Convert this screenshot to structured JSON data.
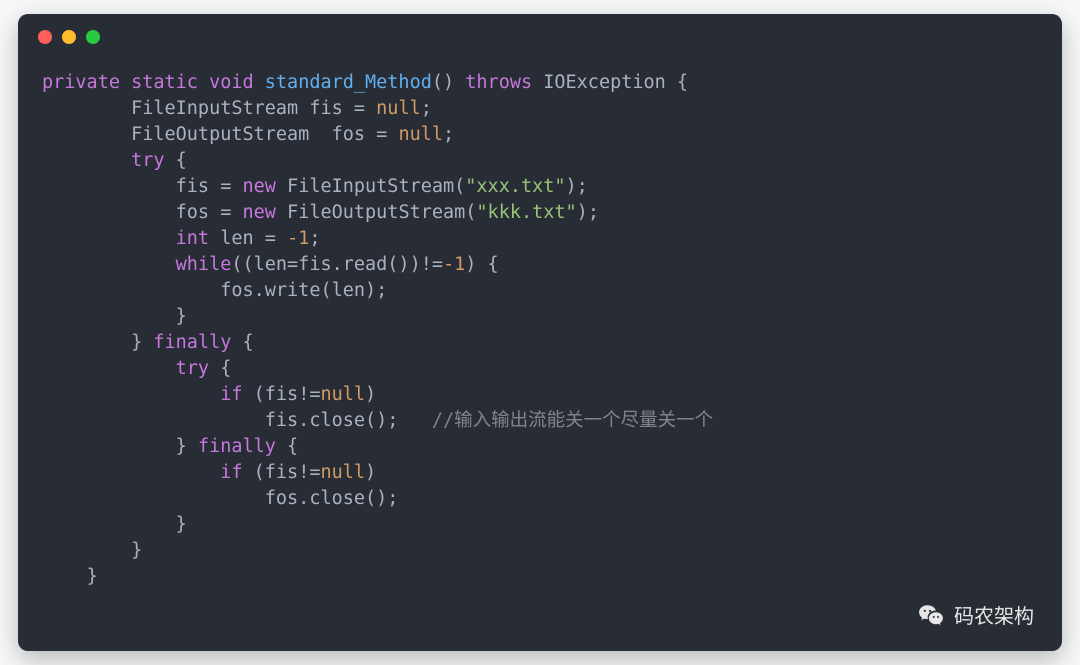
{
  "code": {
    "l1": {
      "kw1": "private",
      "kw2": "static",
      "kw3": "void",
      "fn": "standard_Method",
      "paren": "()",
      "kw4": "throws",
      "ex": "IOException",
      "brace": " {"
    },
    "l2": {
      "type": "FileInputStream",
      "id": "fis",
      "eq": " = ",
      "null": "null",
      "semi": ";"
    },
    "l3": {
      "type": "FileOutputStream",
      "id": "fos",
      "eq": " = ",
      "null": "null",
      "semi": ";"
    },
    "l4": {
      "kw": "try",
      "brace": " {"
    },
    "l5": {
      "id": "fis",
      "eq": " = ",
      "kw": "new",
      "cls": "FileInputStream",
      "lp": "(",
      "str": "\"xxx.txt\"",
      "rp": ")",
      "semi": ";"
    },
    "l6": {
      "id": "fos",
      "eq": " = ",
      "kw": "new",
      "cls": "FileOutputStream",
      "lp": "(",
      "str": "\"kkk.txt\"",
      "rp": ")",
      "semi": ";"
    },
    "l7": {
      "kw": "int",
      "id": "len",
      "eq": " = ",
      "num": "-1",
      "semi": ";"
    },
    "l8": {
      "kw": "while",
      "expr": "((len=fis.read())!=",
      "num": "-1",
      "rp": ")",
      "brace": " {"
    },
    "l9": {
      "call": "fos.write(len);"
    },
    "l10": {
      "brace": "}"
    },
    "l11": {
      "rb": "}",
      "kw": "finally",
      "brace": " {"
    },
    "l12": {
      "kw": "try",
      "brace": " {"
    },
    "l13": {
      "kw": "if",
      "expr": " (fis!=",
      "null": "null",
      "rp": ")"
    },
    "l14": {
      "call": "fis.close();",
      "cmt": "//输入输出流能关一个尽量关一个"
    },
    "l15": {
      "rb": "}",
      "kw": "finally",
      "brace": " {"
    },
    "l16": {
      "kw": "if",
      "expr": " (fis!=",
      "null": "null",
      "rp": ")"
    },
    "l17": {
      "call": "fos.close();"
    },
    "l18": {
      "brace": "}"
    },
    "l19": {
      "brace": "}"
    },
    "l20": {
      "brace": "}"
    }
  },
  "watermark": {
    "text": "码农架构"
  }
}
